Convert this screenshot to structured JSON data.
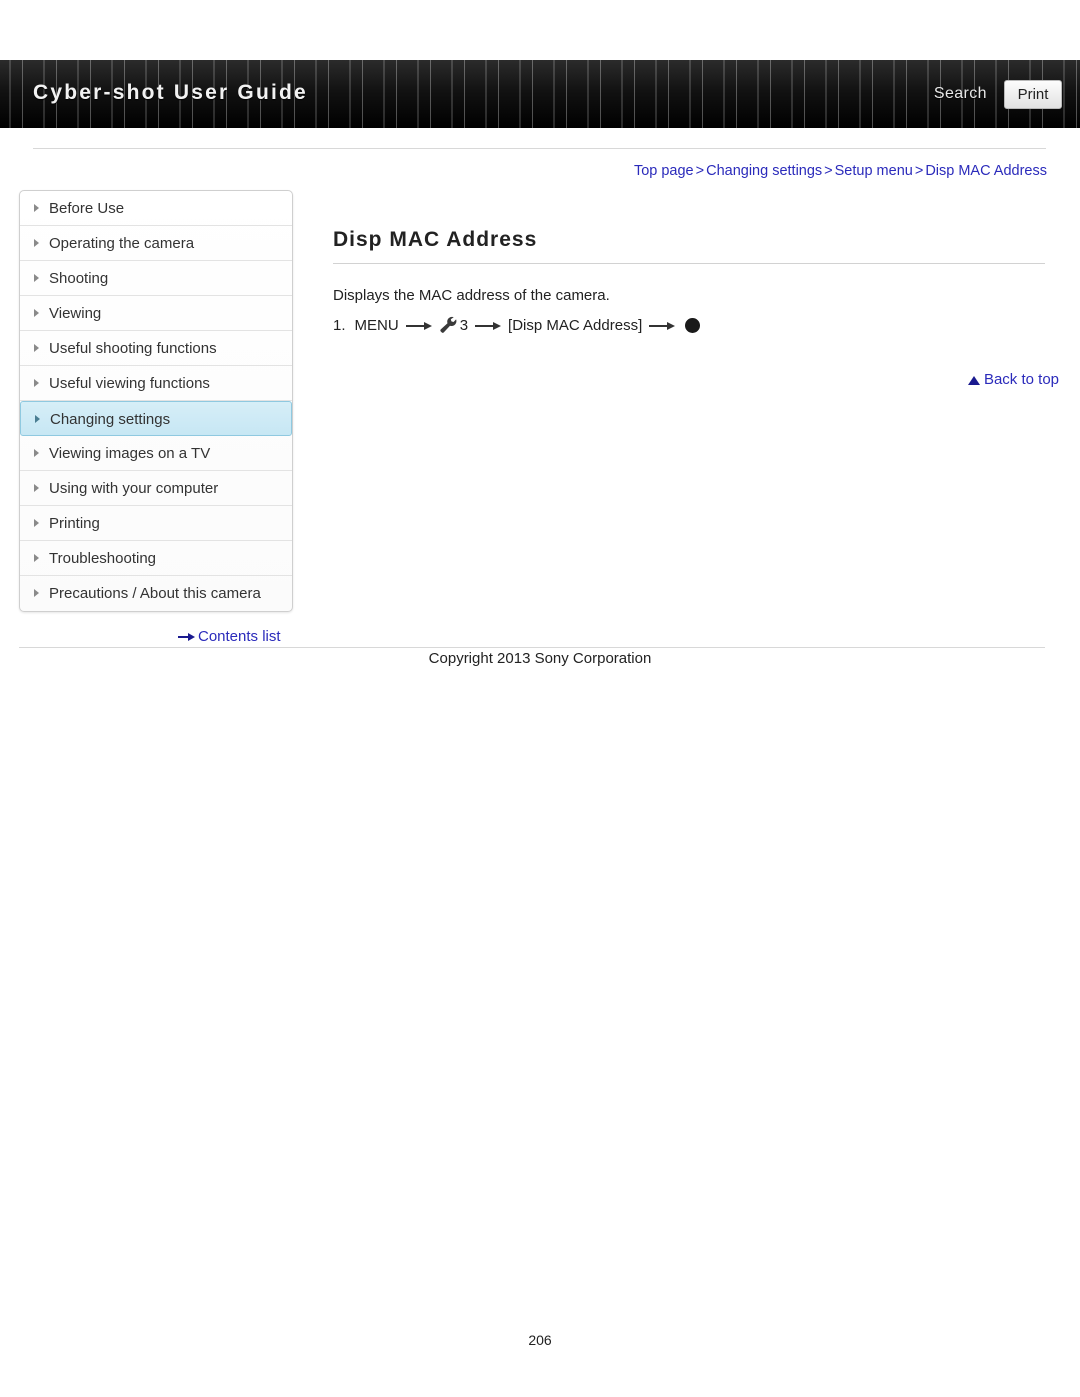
{
  "header": {
    "title": "Cyber-shot User Guide",
    "search_label": "Search",
    "print_label": "Print"
  },
  "breadcrumb": {
    "items": [
      "Top page",
      "Changing settings",
      "Setup menu",
      "Disp MAC Address"
    ],
    "separator": ">"
  },
  "sidebar": {
    "items": [
      {
        "label": "Before Use"
      },
      {
        "label": "Operating the camera"
      },
      {
        "label": "Shooting"
      },
      {
        "label": "Viewing"
      },
      {
        "label": "Useful shooting functions"
      },
      {
        "label": "Useful viewing functions"
      },
      {
        "label": "Changing settings"
      },
      {
        "label": "Viewing images on a TV"
      },
      {
        "label": "Using with your computer"
      },
      {
        "label": "Printing"
      },
      {
        "label": "Troubleshooting"
      },
      {
        "label": "Precautions / About this camera"
      }
    ],
    "selected_index": 6,
    "contents_list_label": "Contents list"
  },
  "main": {
    "title": "Disp MAC Address",
    "description": "Displays the MAC address of the camera.",
    "step": {
      "number": "1.",
      "part1": "MENU",
      "menu_number": "3",
      "part2": "[Disp MAC Address]"
    },
    "back_to_top_label": "Back to top"
  },
  "footer": {
    "copyright": "Copyright 2013 Sony Corporation",
    "page_number": "206"
  },
  "colors": {
    "link": "#2b2bbb",
    "selected_bg": "#cfe9f5"
  }
}
